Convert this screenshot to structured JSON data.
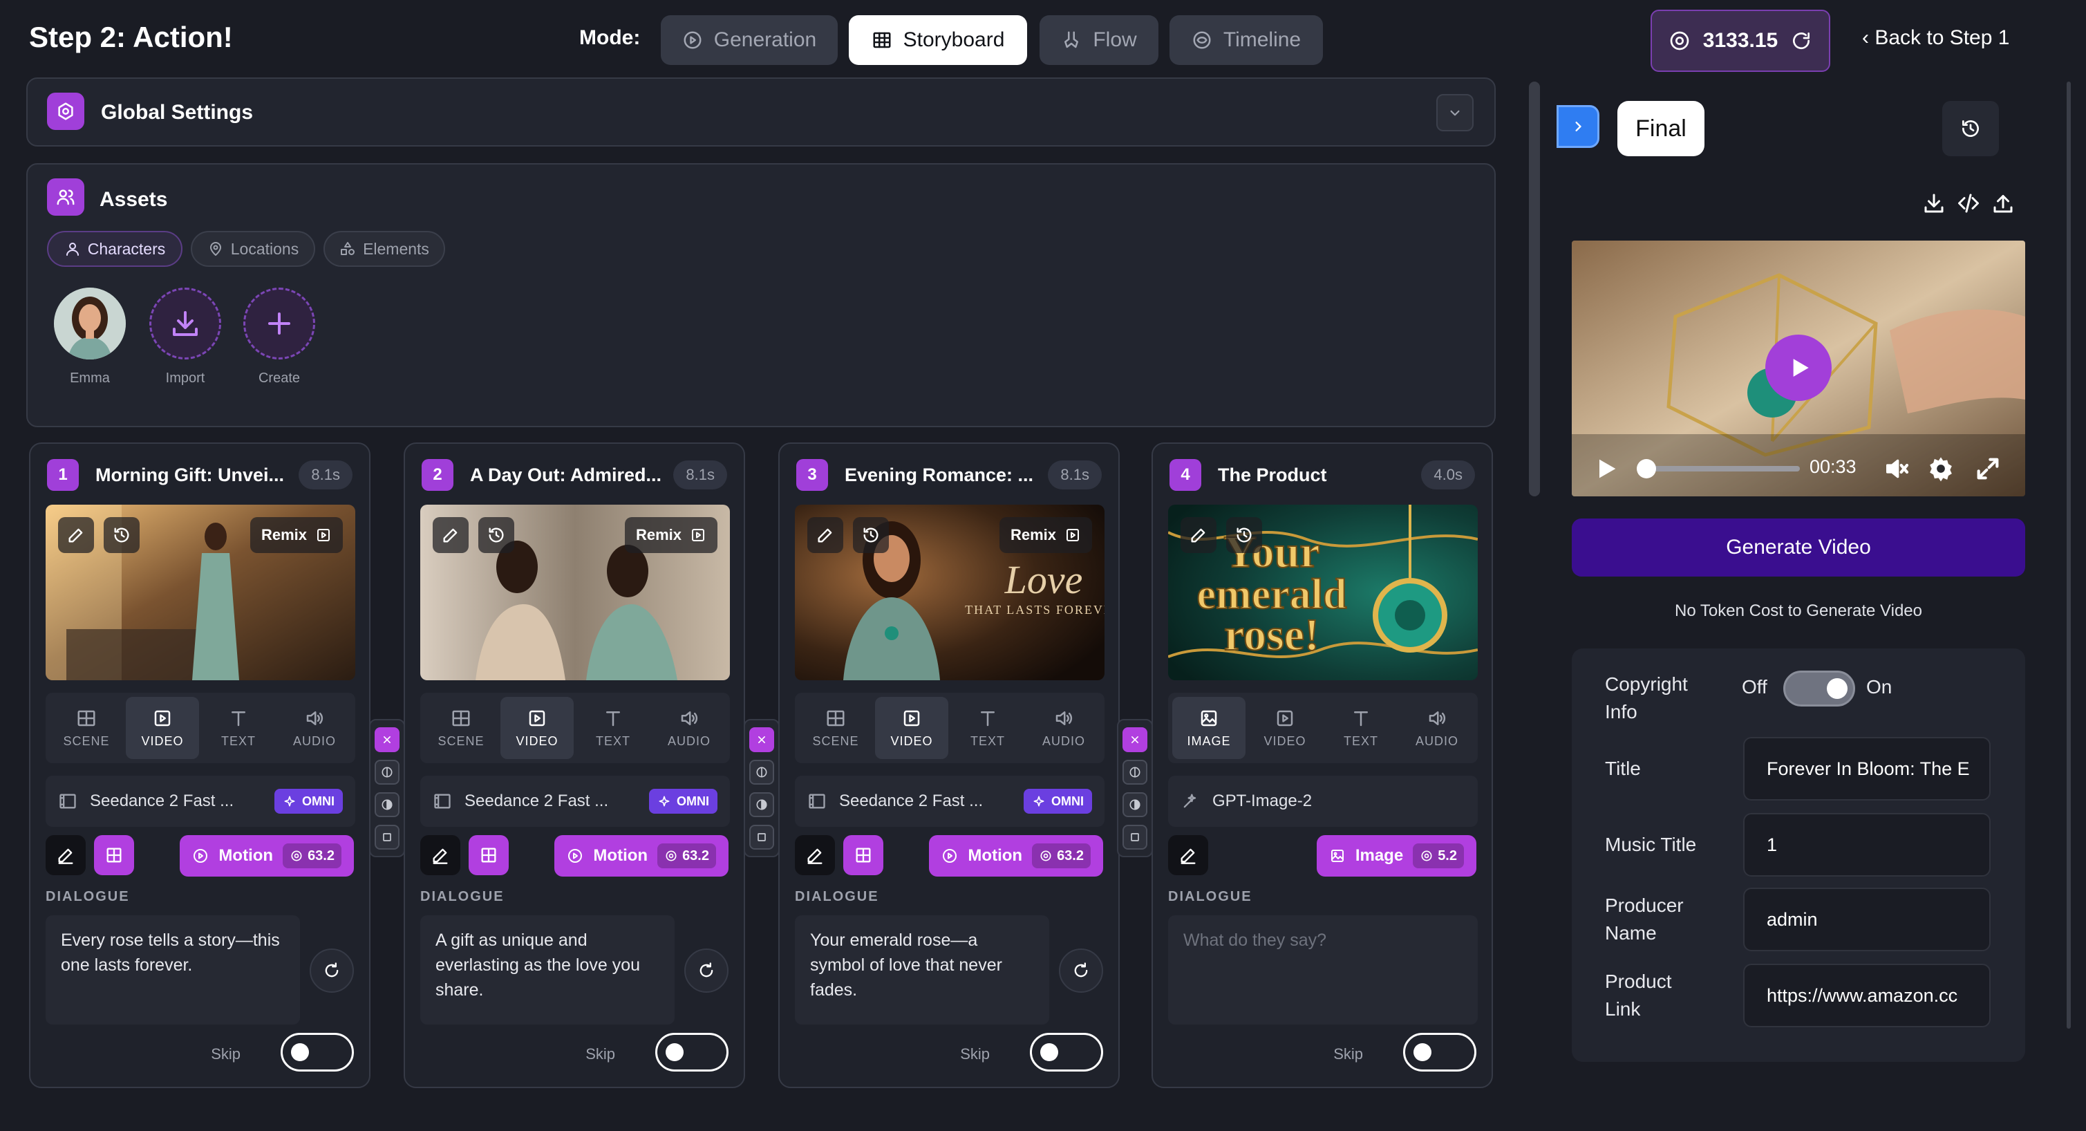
{
  "header": {
    "title": "Step 2: Action!",
    "mode_label": "Mode:",
    "modes": [
      {
        "label": "Generation",
        "icon": "play-circle-icon"
      },
      {
        "label": "Storyboard",
        "icon": "grid-icon"
      },
      {
        "label": "Flow",
        "icon": "flow-icon"
      },
      {
        "label": "Timeline",
        "icon": "timeline-icon"
      }
    ],
    "active_mode": "Storyboard",
    "tokens": "3133.15",
    "back_label": "Back to Step 1"
  },
  "global_settings": {
    "title": "Global Settings"
  },
  "assets": {
    "title": "Assets",
    "chips": [
      "Characters",
      "Locations",
      "Elements"
    ],
    "active_chip": "Characters",
    "items": [
      {
        "label": "Emma"
      },
      {
        "label": "Import"
      },
      {
        "label": "Create"
      }
    ]
  },
  "scenes": [
    {
      "number": "1",
      "title": "Morning Gift: Unvei...",
      "duration": "8.1s",
      "has_remix": true,
      "remix_label": "Remix",
      "tabs": [
        "SCENE",
        "VIDEO",
        "TEXT",
        "AUDIO"
      ],
      "active_tab": "VIDEO",
      "model": "Seedance 2 Fast ...",
      "badge": "OMNI",
      "action_label": "Motion",
      "cost": "63.2",
      "dialogue_label": "DIALOGUE",
      "dialogue": "Every rose tells a story—this one lasts forever.",
      "skip_label": "Skip"
    },
    {
      "number": "2",
      "title": "A Day Out: Admired...",
      "duration": "8.1s",
      "has_remix": true,
      "remix_label": "Remix",
      "tabs": [
        "SCENE",
        "VIDEO",
        "TEXT",
        "AUDIO"
      ],
      "active_tab": "VIDEO",
      "model": "Seedance 2 Fast ...",
      "badge": "OMNI",
      "action_label": "Motion",
      "cost": "63.2",
      "dialogue_label": "DIALOGUE",
      "dialogue": "A gift as unique and everlasting as the love you share.",
      "skip_label": "Skip"
    },
    {
      "number": "3",
      "title": "Evening Romance: ...",
      "duration": "8.1s",
      "has_remix": true,
      "remix_label": "Remix",
      "tabs": [
        "SCENE",
        "VIDEO",
        "TEXT",
        "AUDIO"
      ],
      "active_tab": "VIDEO",
      "model": "Seedance 2 Fast ...",
      "badge": "OMNI",
      "action_label": "Motion",
      "cost": "63.2",
      "dialogue_label": "DIALOGUE",
      "dialogue": "Your emerald rose—a symbol of love that never fades.",
      "overlay_text_main": "Love",
      "overlay_text_sub": "THAT LASTS FOREVER",
      "skip_label": "Skip"
    },
    {
      "number": "4",
      "title": "The Product",
      "duration": "4.0s",
      "has_remix": false,
      "tabs": [
        "IMAGE",
        "VIDEO",
        "TEXT",
        "AUDIO"
      ],
      "active_tab": "IMAGE",
      "model": "GPT-Image-2",
      "action_label": "Image",
      "cost": "5.2",
      "dialogue_label": "DIALOGUE",
      "dialogue_placeholder": "What do they say?",
      "overlay_text_lines": [
        "Your",
        "emerald",
        "rose!"
      ],
      "skip_label": "Skip"
    }
  ],
  "preview": {
    "label": "Final",
    "time": "00:33",
    "progress": 0.0,
    "generate_label": "Generate Video",
    "note": "No Token Cost to Generate Video"
  },
  "info": {
    "copyright_label": "Copyright Info",
    "off_label": "Off",
    "on_label": "On",
    "copyright_on": true,
    "fields": [
      {
        "label": "Title",
        "value": "Forever In Bloom: The E"
      },
      {
        "label": "Music Title",
        "value": "1"
      },
      {
        "label": "Producer Name",
        "value": "admin"
      },
      {
        "label": "Product Link",
        "value": "https://www.amazon.cc"
      }
    ]
  },
  "colors": {
    "accent": "#a03fd9",
    "button_purple": "#b13fe0",
    "generate": "#3a0e8f",
    "background": "#1a1c24",
    "omni": "#6b3fe0"
  }
}
